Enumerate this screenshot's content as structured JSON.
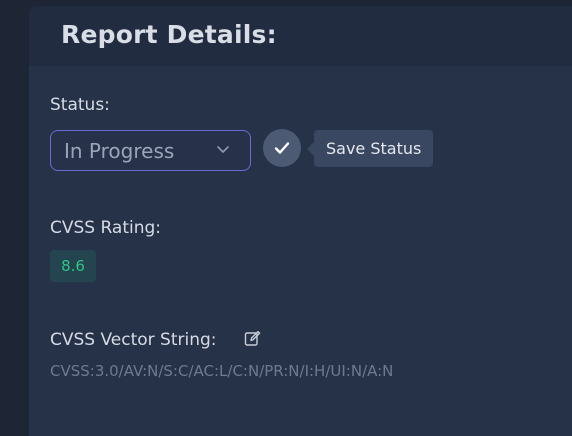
{
  "panel": {
    "title": "Report Details:"
  },
  "status": {
    "label": "Status:",
    "selected": "In Progress",
    "save_tooltip": "Save Status"
  },
  "cvss": {
    "label": "CVSS Rating:",
    "score": "8.6",
    "score_color": "#2ec486"
  },
  "vector": {
    "label": "CVSS Vector String:",
    "value": "CVSS:3.0/AV:N/S:C/AC:L/C:N/PR:N/I:H/UI:N/A:N"
  },
  "icons": {
    "dropdown": "chevron-down-icon",
    "save": "check-icon",
    "edit": "edit-icon",
    "severity_ring": "ring-chart"
  },
  "colors": {
    "accent_border": "#6a6bd6",
    "severity_ring": "#c8283a"
  }
}
